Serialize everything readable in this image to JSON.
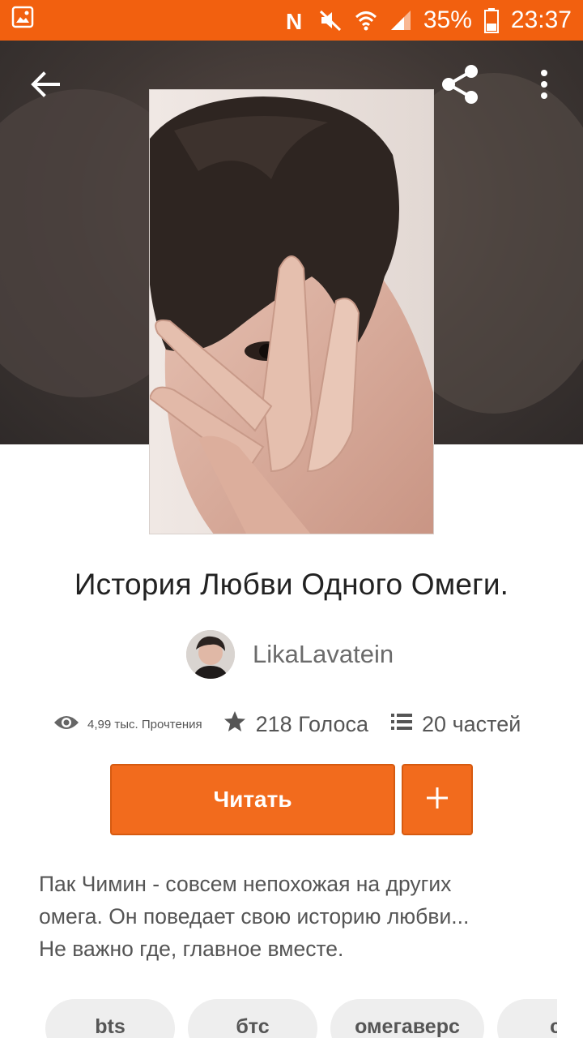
{
  "status_bar": {
    "battery": "35%",
    "time": "23:37",
    "icons": [
      "gallery-icon",
      "nfc-icon",
      "mute-icon",
      "wifi-icon",
      "signal-icon",
      "battery-icon"
    ]
  },
  "header": {
    "icons": [
      "back-arrow-icon",
      "share-icon",
      "more-vertical-icon"
    ]
  },
  "story": {
    "title": "История Любви Одного Омеги.",
    "author": "LikaLavatein",
    "stats": {
      "reads": "4,99 тыс. Прочтения",
      "votes": "218 Голоса",
      "parts": "20 частей"
    },
    "read_label": "Читать",
    "add_label": "+",
    "description": "Пак Чимин - совсем непохожая на других\nомега. Он поведает свою историю любви...\nНе важно где, главное вместе.",
    "tags": [
      "bts",
      "бтс",
      "омегаверс",
      "сл"
    ]
  },
  "colors": {
    "accent": "#f26b1d",
    "status_bar": "#f2600f"
  }
}
